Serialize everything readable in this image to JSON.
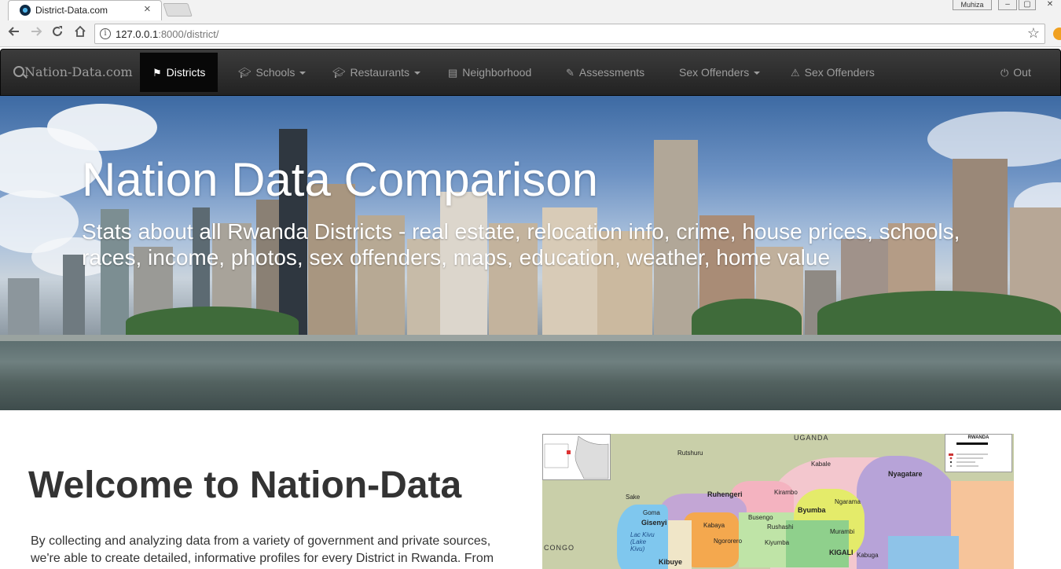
{
  "browser": {
    "tab_title": "District-Data.com",
    "tab_close": "×",
    "user_label": "Muhiza",
    "win_min": "–",
    "win_max": "▢",
    "win_close": "✕",
    "url_host": "127.0.0.1",
    "url_rest": ":8000/district/",
    "icons": [
      "back-icon",
      "forward-icon",
      "reload-icon",
      "home-icon",
      "info-icon",
      "star-icon"
    ]
  },
  "navbar": {
    "brand": "Nation-Data.com",
    "items": [
      {
        "label": "Districts",
        "icon": "flag-icon"
      },
      {
        "label": "Schools",
        "icon": "graduation-cap-icon"
      },
      {
        "label": "Restaurants",
        "icon": "graduation-cap-icon"
      },
      {
        "label": "Neighborhood",
        "icon": "file-icon"
      },
      {
        "label": "Assessments",
        "icon": "edit-icon"
      },
      {
        "label": "Sex Offenders"
      },
      {
        "label": "Sex Offenders",
        "icon": "warning-icon"
      },
      {
        "label": "Out",
        "icon": "power-icon"
      }
    ]
  },
  "hero": {
    "title": "Nation Data Comparison",
    "subtitle": "Stats about all Rwanda Districts - real estate, relocation info, crime, house prices, schools, races, income, photos, sex offenders, maps, education, weather, home value"
  },
  "welcome": {
    "heading": "Welcome to Nation-Data",
    "intro": "By collecting and analyzing data from a variety of government and private sources, we're able to create detailed, informative profiles for every District in Rwanda. From"
  },
  "map": {
    "legend_title": "RWANDA",
    "labels": {
      "uganda": "UGANDA",
      "congo": "CONGO",
      "nyagatare": "Nyagatare",
      "ruhengeri": "Ruhengeri",
      "byumba": "Byumba",
      "gisenyi": "Gisenyi",
      "kigali": "KIGALI",
      "kibuye": "Kibuye",
      "lake_kivu": "Lac Kivu (Lake Kivu)",
      "kabale": "Kabale",
      "rutshuru": "Rutshuru",
      "ngarama": "Ngarama",
      "kirambo": "Kirambo",
      "busengo": "Busengo",
      "ngororero": "Ngororero",
      "rushashi": "Rushashi",
      "kabaya": "Kabaya",
      "goma": "Goma",
      "sake": "Sake",
      "murambi": "Murambi",
      "kiyumba": "Kiyumba",
      "kabuga": "Kabuga"
    }
  }
}
